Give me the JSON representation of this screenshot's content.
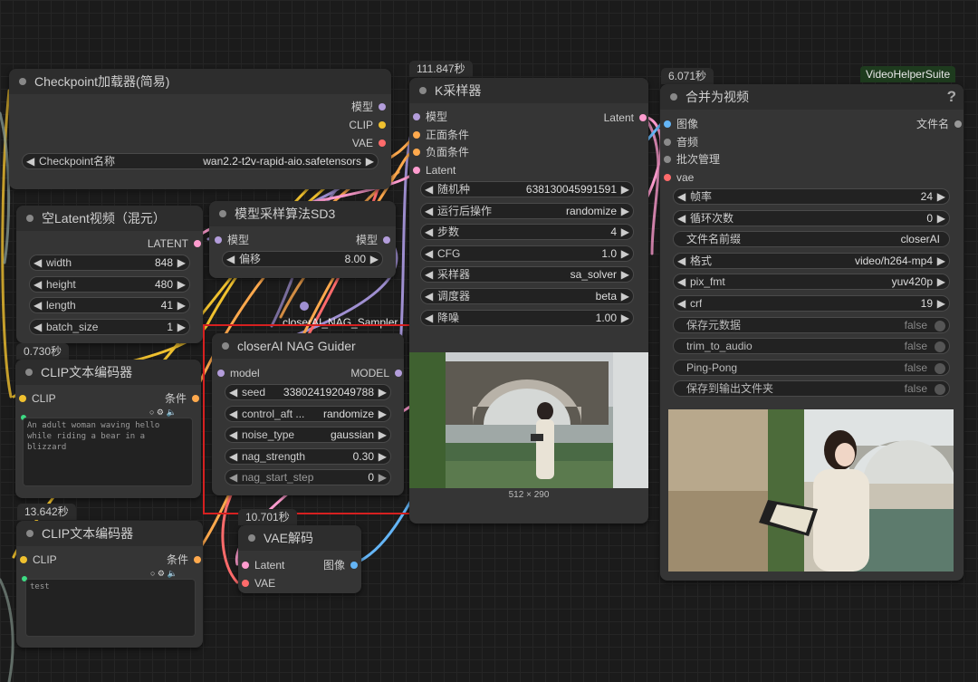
{
  "colors": {
    "clip": "#f0c12f",
    "model": "#b39ddb",
    "vae": "#ff6b6b",
    "latent": "#ff9ccf",
    "image": "#64b5f6",
    "conditioning": "#ffa94d",
    "selection": "#d62020"
  },
  "ckpt": {
    "title": "Checkpoint加载器(简易)",
    "out_model": "模型",
    "out_clip": "CLIP",
    "out_vae": "VAE",
    "w_name": "Checkpoint名称",
    "w_value": "wan2.2-t2v-rapid-aio.safetensors"
  },
  "empty_latent": {
    "title": "空Latent视频（混元）",
    "out_latent": "LATENT",
    "widgets": [
      {
        "name": "width",
        "value": "848"
      },
      {
        "name": "height",
        "value": "480"
      },
      {
        "name": "length",
        "value": "41"
      },
      {
        "name": "batch_size",
        "value": "1"
      }
    ]
  },
  "sd3": {
    "title": "模型采样算法SD3",
    "in_model": "模型",
    "out_model": "模型",
    "w_name": "偏移",
    "w_value": "8.00"
  },
  "clip_top": {
    "badge": "0.730秒",
    "title": "CLIP文本编码器",
    "in_clip": "CLIP",
    "out_cond": "条件",
    "text": "An adult woman waving hello while riding a bear in a blizzard"
  },
  "clip_bottom": {
    "badge": "13.642秒",
    "title": "CLIP文本编码器",
    "in_clip": "CLIP",
    "out_cond": "条件",
    "text": "test"
  },
  "nag": {
    "header_label": "closerAI_NAG_Sampler",
    "title": "closerAI NAG Guider",
    "in_model": "model",
    "out_model": "MODEL",
    "widgets": [
      {
        "name": "seed",
        "value": "338024192049788"
      },
      {
        "name": "control_aft ...",
        "value": "randomize"
      },
      {
        "name": "noise_type",
        "value": "gaussian"
      },
      {
        "name": "nag_strength",
        "value": "0.30"
      },
      {
        "name": "nag_start_step",
        "value": "0"
      }
    ]
  },
  "ksampler": {
    "badge": "111.847秒",
    "title": "K采样器",
    "inputs": [
      {
        "label": "模型"
      },
      {
        "label": "正面条件"
      },
      {
        "label": "负面条件"
      },
      {
        "label": "Latent"
      }
    ],
    "out_latent": "Latent",
    "widgets": [
      {
        "name": "随机种",
        "value": "638130045991591"
      },
      {
        "name": "运行后操作",
        "value": "randomize"
      },
      {
        "name": "步数",
        "value": "4"
      },
      {
        "name": "CFG",
        "value": "1.0"
      },
      {
        "name": "采样器",
        "value": "sa_solver"
      },
      {
        "name": "调度器",
        "value": "beta"
      },
      {
        "name": "降噪",
        "value": "1.00"
      }
    ],
    "preview_size": "512 × 290"
  },
  "vae_decode": {
    "badge": "10.701秒",
    "title": "VAE解码",
    "in_latent": "Latent",
    "in_vae": "VAE",
    "out_image": "图像"
  },
  "combine": {
    "badge": "6.071秒",
    "suite": "VideoHelperSuite",
    "title": "合并为视频",
    "help": "?",
    "inputs": [
      {
        "label": "图像"
      },
      {
        "label": "音频"
      },
      {
        "label": "批次管理"
      },
      {
        "label": "vae"
      }
    ],
    "out_filename": "文件名",
    "arrow_widgets": [
      {
        "name": "帧率",
        "value": "24"
      },
      {
        "name": "循环次数",
        "value": "0"
      }
    ],
    "prefix": {
      "name": "文件名前缀",
      "value": "closerAI"
    },
    "arrow_widgets2": [
      {
        "name": "格式",
        "value": "video/h264-mp4"
      },
      {
        "name": "pix_fmt",
        "value": "yuv420p"
      },
      {
        "name": "crf",
        "value": "19"
      }
    ],
    "toggles": [
      {
        "name": "保存元数据",
        "value": "false"
      },
      {
        "name": "trim_to_audio",
        "value": "false"
      },
      {
        "name": "Ping-Pong",
        "value": "false"
      },
      {
        "name": "保存到输出文件夹",
        "value": "false"
      }
    ]
  }
}
